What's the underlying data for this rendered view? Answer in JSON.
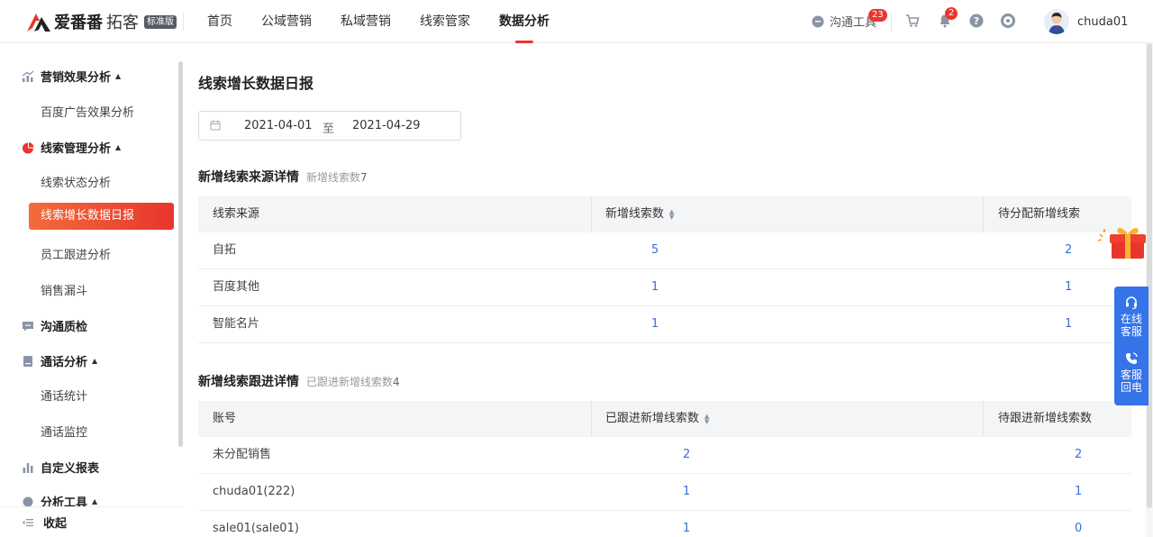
{
  "header": {
    "brand": "爱番番",
    "product": "拓客",
    "edition_badge": "标准版",
    "nav": [
      "首页",
      "公域营销",
      "私域营销",
      "线索管家",
      "数据分析"
    ],
    "active_nav": "数据分析",
    "chat_tool_label": "沟通工具",
    "chat_badge": "23",
    "notification_badge": "2",
    "username": "chuda01"
  },
  "sidebar": {
    "groups": [
      {
        "label": "营销效果分析",
        "items": [
          "百度广告效果分析"
        ]
      },
      {
        "label": "线索管理分析",
        "items": [
          "线索状态分析",
          "线索增长数据日报",
          "员工跟进分析",
          "销售漏斗"
        ]
      },
      {
        "label": "沟通质检",
        "items": []
      },
      {
        "label": "通话分析",
        "items": [
          "通话统计",
          "通话监控"
        ]
      },
      {
        "label": "自定义报表",
        "items": []
      },
      {
        "label": "分析工具",
        "items": []
      }
    ],
    "active_item": "线索增长数据日报",
    "collapse_label": "收起"
  },
  "page": {
    "title": "线索增长数据日报",
    "date_start": "2021-04-01",
    "date_separator": "至",
    "date_end": "2021-04-29"
  },
  "source_section": {
    "title": "新增线索来源详情",
    "sub_label": "新增线索数",
    "sub_value": "7",
    "columns": [
      "线索来源",
      "新增线索数",
      "待分配新增线索"
    ],
    "rows": [
      [
        "自拓",
        "5",
        "2"
      ],
      [
        "百度其他",
        "1",
        "1"
      ],
      [
        "智能名片",
        "1",
        "1"
      ]
    ]
  },
  "followup_section": {
    "title": "新增线索跟进详情",
    "sub_label": "已跟进新增线索数",
    "sub_value": "4",
    "columns": [
      "账号",
      "已跟进新增线索数",
      "待跟进新增线索数"
    ],
    "rows": [
      [
        "未分配销售",
        "2",
        "2"
      ],
      [
        "chuda01(222)",
        "1",
        "1"
      ],
      [
        "sale01(sale01)",
        "1",
        "0"
      ]
    ]
  },
  "float_panel": {
    "online_service": "在线\n客服",
    "callback": "客服\n回电"
  },
  "colors": {
    "accent": "#e8362e",
    "link": "#3d6fd8",
    "float_panel": "#3573e8"
  }
}
